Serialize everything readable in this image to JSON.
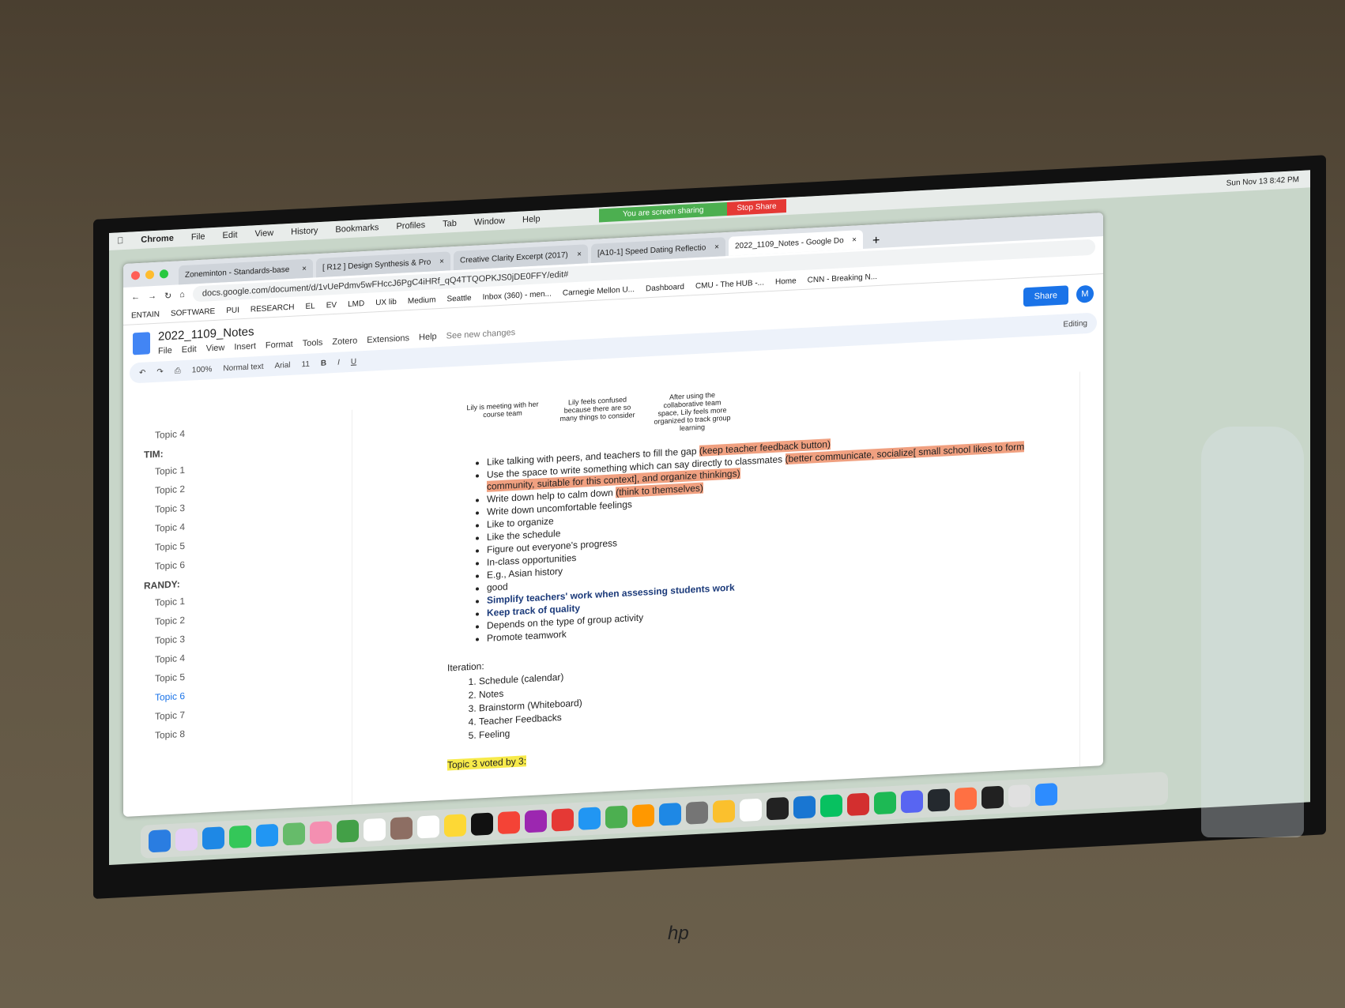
{
  "menubar": {
    "app": "Chrome",
    "items": [
      "File",
      "Edit",
      "View",
      "History",
      "Bookmarks",
      "Profiles",
      "Tab",
      "Window",
      "Help"
    ],
    "clock": "Sun Nov 13  8:42 PM"
  },
  "sharing": {
    "status": "You are screen sharing",
    "stop": "Stop Share"
  },
  "tabs": [
    "Zoneminton - Standards-base",
    "[ R12 ] Design Synthesis & Pro",
    "Creative Clarity Excerpt (2017)",
    "[A10-1] Speed Dating Reflectio",
    "2022_1109_Notes - Google Do"
  ],
  "url": "docs.google.com/document/d/1vUePdmv5wFHccJ6PgC4iHRf_qQ4TTQOPKJS0jDE0FFY/edit#",
  "bookmarks": [
    "ENTAIN",
    "SOFTWARE",
    "PUI",
    "RESEARCH",
    "EL",
    "EV",
    "LMD",
    "UX lib",
    "Medium",
    "Seattle",
    "Inbox (360) - men...",
    "Carnegie Mellon U...",
    "Dashboard",
    "CMU - The HUB -...",
    "Home",
    "CNN - Breaking N..."
  ],
  "doc": {
    "title": "2022_1109_Notes",
    "menus": [
      "File",
      "Edit",
      "View",
      "Insert",
      "Format",
      "Tools",
      "Zotero",
      "Extensions",
      "Help",
      "See new changes"
    ],
    "share": "Share",
    "avatar": "M",
    "mode": "Editing"
  },
  "toolbar": {
    "zoom": "100%",
    "style": "Normal text",
    "font": "Arial",
    "size": "11"
  },
  "outline": {
    "pre": "Topic 4",
    "groups": [
      {
        "name": "TIM:",
        "topics": [
          "Topic 1",
          "Topic 2",
          "Topic 3",
          "Topic 4",
          "Topic 5",
          "Topic 6"
        ]
      },
      {
        "name": "RANDY:",
        "topics": [
          "Topic 1",
          "Topic 2",
          "Topic 3",
          "Topic 4",
          "Topic 5",
          "Topic 6",
          "Topic 7",
          "Topic 8"
        ]
      }
    ]
  },
  "captions": [
    "Lily is meeting with her course team",
    "Lily feels confused because there are so many things to consider",
    "After using the collaborative team space, Lily feels more organized to track group learning"
  ],
  "bullets": [
    {
      "text": "Like talking with peers, and teachers to fill the gap ",
      "hl": "(keep teacher feedback button)"
    },
    {
      "text": "Use the space to write something which can say directly to classmates ",
      "hl": "(better communicate, socialize[ small school likes to form community, suitable for this context], and organize thinkings)"
    },
    {
      "text": "Write down help to calm down ",
      "hl": "(think to themselves)"
    },
    {
      "text": "Write down uncomfortable feelings"
    },
    {
      "text": "Like to organize"
    },
    {
      "text": "Like the schedule"
    },
    {
      "text": "Figure out everyone's progress"
    },
    {
      "text": "In-class opportunities"
    },
    {
      "text": "E.g., Asian history"
    },
    {
      "text": "good"
    },
    {
      "text": "Simplify teachers' work when assessing students work",
      "bold": true
    },
    {
      "text": "Keep track of quality",
      "bold": true
    },
    {
      "text": "Depends on the type of group activity"
    },
    {
      "text": "Promote teamwork"
    }
  ],
  "iteration": {
    "label": "Iteration:",
    "items": [
      "Schedule (calendar)",
      "Notes",
      "Brainstorm (Whiteboard)",
      "Teacher Feedbacks",
      "Feeling"
    ]
  },
  "voted": "Topic 3 voted by 3:",
  "monitor_brand": "hp"
}
